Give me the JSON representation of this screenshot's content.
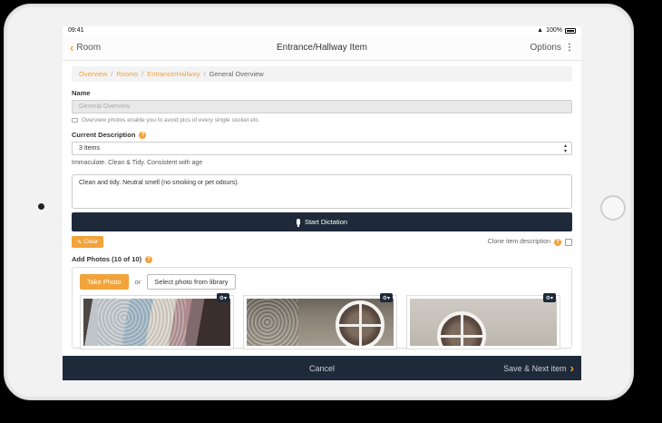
{
  "status_bar": {
    "time": "09:41",
    "battery": "100%"
  },
  "nav": {
    "back_label": "Room",
    "title": "Entrance/Hallway Item",
    "options_label": "Options"
  },
  "breadcrumb": {
    "items": [
      "Overview",
      "Rooms",
      "Entrance/Hallway"
    ],
    "current": "General Overview"
  },
  "name_field": {
    "label": "Name",
    "value": "General Overview",
    "hint": "Overview photos enable you to avoid pics of every single socket etc."
  },
  "description": {
    "label": "Current Description",
    "selected": "3 Items",
    "summary": "Immaculate. Clean & Tidy. Consistent with age",
    "text": "Clean and tidy.  Neutral smell (no smoking or pet odours)."
  },
  "dictation": {
    "label": "Start Dictation"
  },
  "clear_button": {
    "label": "Clear"
  },
  "clone": {
    "label": "Clone item description"
  },
  "photos": {
    "label": "Add Photos (10 of 10)",
    "take_label": "Take Photo",
    "or_label": "or",
    "library_label": "Select photo from library"
  },
  "footer": {
    "cancel_label": "Cancel",
    "next_label": "Save & Next item"
  },
  "colors": {
    "accent": "#f2a33a",
    "dark": "#1e2a39"
  }
}
